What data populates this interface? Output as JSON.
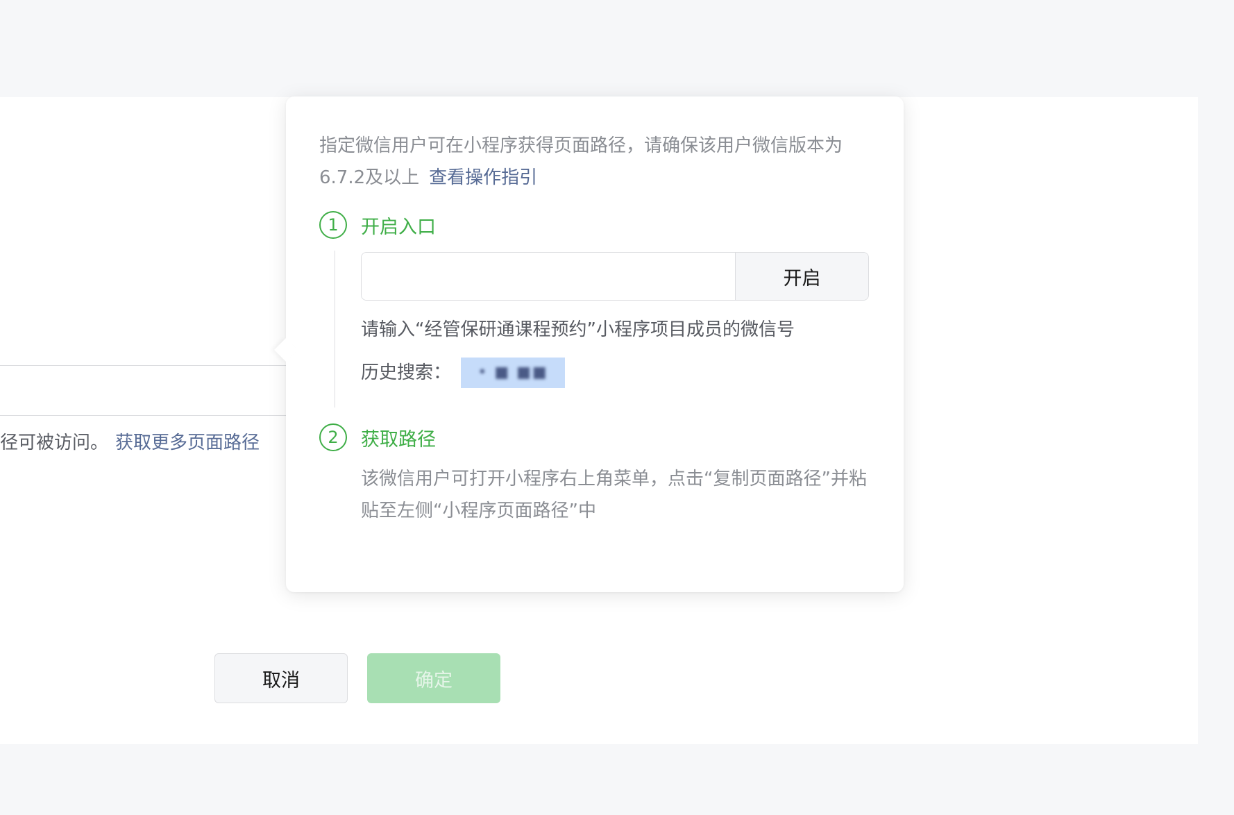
{
  "background": {
    "notice_text": "径可被访问。",
    "notice_link": "获取更多页面路径"
  },
  "popover": {
    "intro_text": "指定微信用户可在小程序获得页面路径，请确保该用户微信版本为6.7.2及以上",
    "intro_link": "查看操作指引",
    "step1": {
      "number": "1",
      "title": "开启入口",
      "input_value": "",
      "input_placeholder": "",
      "open_button": "开启",
      "hint": "请输入“经管保研通课程预约”小程序项目成员的微信号",
      "history_label": "历史搜索：",
      "history_value": "•  ■ ■■"
    },
    "step2": {
      "number": "2",
      "title": "获取路径",
      "description": "该微信用户可打开小程序右上角菜单，点击“复制页面路径”并粘贴至左侧“小程序页面路径”中"
    }
  },
  "footer": {
    "cancel_button": "取消",
    "confirm_button": "确定"
  },
  "colors": {
    "accent_green": "#3fae47",
    "link_blue": "#576b95",
    "disabled_green": "#a8dfb3"
  }
}
